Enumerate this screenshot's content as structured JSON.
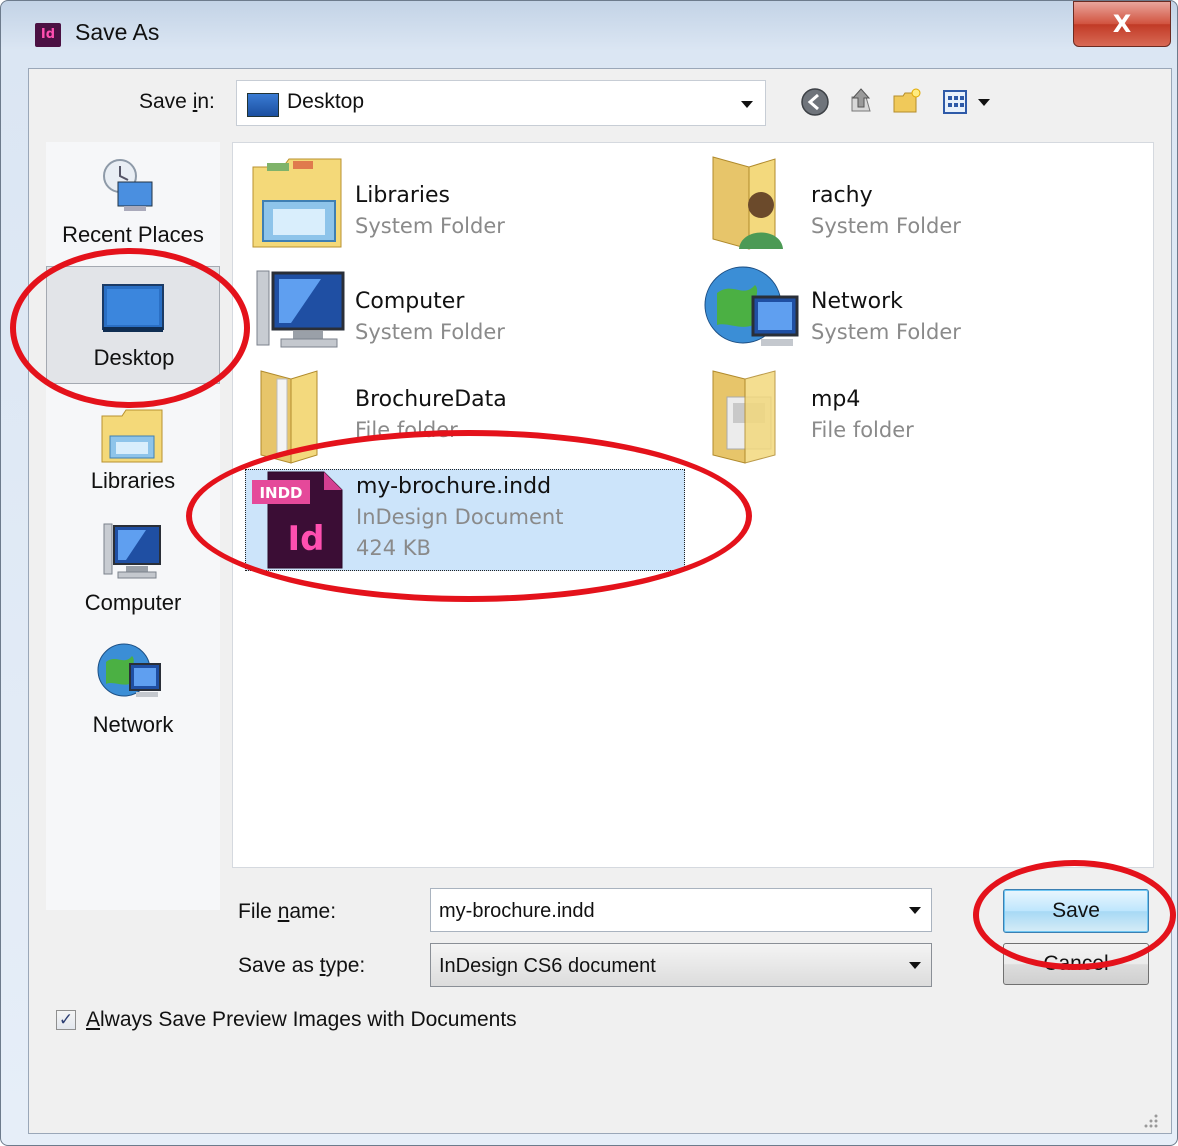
{
  "window": {
    "title": "Save As",
    "app_icon_text": "Id",
    "close_glyph": "X"
  },
  "toolbar": {
    "save_in_label": "Save in:",
    "save_in_value": "Desktop",
    "icons": [
      "back-icon",
      "up-folder-icon",
      "new-folder-icon",
      "view-menu-icon"
    ]
  },
  "places": [
    {
      "label": "Recent Places",
      "icon": "recent-places-icon"
    },
    {
      "label": "Desktop",
      "icon": "desktop-icon",
      "selected": true
    },
    {
      "label": "Libraries",
      "icon": "libraries-icon"
    },
    {
      "label": "Computer",
      "icon": "computer-icon"
    },
    {
      "label": "Network",
      "icon": "network-icon"
    }
  ],
  "files": [
    {
      "name": "Libraries",
      "type": "System Folder",
      "icon": "libraries-folder-icon"
    },
    {
      "name": "rachy",
      "type": "System Folder",
      "icon": "user-folder-icon"
    },
    {
      "name": "Computer",
      "type": "System Folder",
      "icon": "computer-icon"
    },
    {
      "name": "Network",
      "type": "System Folder",
      "icon": "network-icon"
    },
    {
      "name": "BrochureData",
      "type": "File folder",
      "icon": "folder-icon"
    },
    {
      "name": "mp4",
      "type": "File folder",
      "icon": "folder-icon"
    },
    {
      "name": "my-brochure.indd",
      "type": "InDesign Document",
      "size": "424 KB",
      "icon": "indesign-file-icon",
      "badge": "INDD",
      "logo": "Id",
      "selected": true
    }
  ],
  "form": {
    "file_name_label": "File name:",
    "file_name_value": "my-brochure.indd",
    "save_type_label": "Save as type:",
    "save_type_value": "InDesign CS6 document",
    "save_button": "Save",
    "cancel_button": "Cancel",
    "preview_checkbox_label": "Always Save Preview Images with Documents",
    "preview_checked": true
  },
  "colors": {
    "annotation": "#e4121b",
    "selection": "#cce4fa",
    "indesign": "#4b1143"
  }
}
